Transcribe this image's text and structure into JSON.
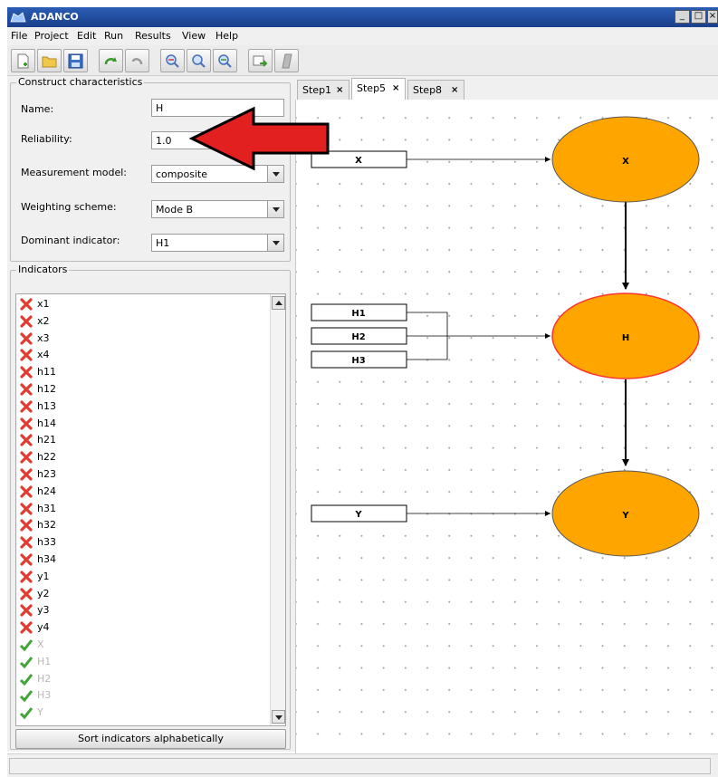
{
  "window": {
    "title": "ADANCO",
    "controls": [
      "_",
      "□",
      "×"
    ]
  },
  "menu": [
    "File",
    "Project",
    "Edit",
    "Run",
    "Results",
    "View",
    "Help"
  ],
  "toolbar_icons": [
    "new-file-icon",
    "open-folder-icon",
    "save-icon",
    "redo-icon",
    "undo-icon",
    "zoom-fit-icon",
    "zoom-in-icon",
    "zoom-out-icon",
    "export-icon",
    "properties-icon"
  ],
  "construct": {
    "legend": "Construct characteristics",
    "name_label": "Name:",
    "name_value": "H",
    "reliability_label": "Reliability:",
    "reliability_value": "1.0",
    "measurement_label": "Measurement model:",
    "measurement_value": "composite",
    "weighting_label": "Weighting scheme:",
    "weighting_value": "Mode B",
    "dominant_label": "Dominant indicator:",
    "dominant_value": "H1"
  },
  "indicators": {
    "legend": "Indicators",
    "items": [
      {
        "label": "x1",
        "assigned": false
      },
      {
        "label": "x2",
        "assigned": false
      },
      {
        "label": "x3",
        "assigned": false
      },
      {
        "label": "x4",
        "assigned": false
      },
      {
        "label": "h11",
        "assigned": false
      },
      {
        "label": "h12",
        "assigned": false
      },
      {
        "label": "h13",
        "assigned": false
      },
      {
        "label": "h14",
        "assigned": false
      },
      {
        "label": "h21",
        "assigned": false
      },
      {
        "label": "h22",
        "assigned": false
      },
      {
        "label": "h23",
        "assigned": false
      },
      {
        "label": "h24",
        "assigned": false
      },
      {
        "label": "h31",
        "assigned": false
      },
      {
        "label": "h32",
        "assigned": false
      },
      {
        "label": "h33",
        "assigned": false
      },
      {
        "label": "h34",
        "assigned": false
      },
      {
        "label": "y1",
        "assigned": false
      },
      {
        "label": "y2",
        "assigned": false
      },
      {
        "label": "y3",
        "assigned": false
      },
      {
        "label": "y4",
        "assigned": false
      },
      {
        "label": "X",
        "assigned": true
      },
      {
        "label": "H1",
        "assigned": true
      },
      {
        "label": "H2",
        "assigned": true
      },
      {
        "label": "H3",
        "assigned": true
      },
      {
        "label": "Y",
        "assigned": true
      }
    ],
    "sort_button": "Sort indicators alphabetically"
  },
  "tabs": [
    {
      "label": "Step1",
      "active": false
    },
    {
      "label": "Step5",
      "active": true
    },
    {
      "label": "Step8",
      "active": false
    }
  ],
  "tab_close": "×",
  "model": {
    "constructs": [
      {
        "id": "X",
        "label": "X",
        "selected": false
      },
      {
        "id": "H",
        "label": "H",
        "selected": true
      },
      {
        "id": "Y",
        "label": "Y",
        "selected": false
      }
    ],
    "indicators": [
      {
        "label": "X",
        "construct": "X"
      },
      {
        "label": "H1",
        "construct": "H"
      },
      {
        "label": "H2",
        "construct": "H"
      },
      {
        "label": "H3",
        "construct": "H"
      },
      {
        "label": "Y",
        "construct": "Y"
      }
    ],
    "paths": [
      [
        "X",
        "H"
      ],
      [
        "H",
        "Y"
      ]
    ]
  },
  "colors": {
    "construct_fill": "#FFA500",
    "selected_outline": "#FF3333",
    "annotation_arrow": "#E32020",
    "title_bar": "#1F4A9F",
    "error_mark": "#E03C31",
    "ok_mark": "#3FA535"
  }
}
